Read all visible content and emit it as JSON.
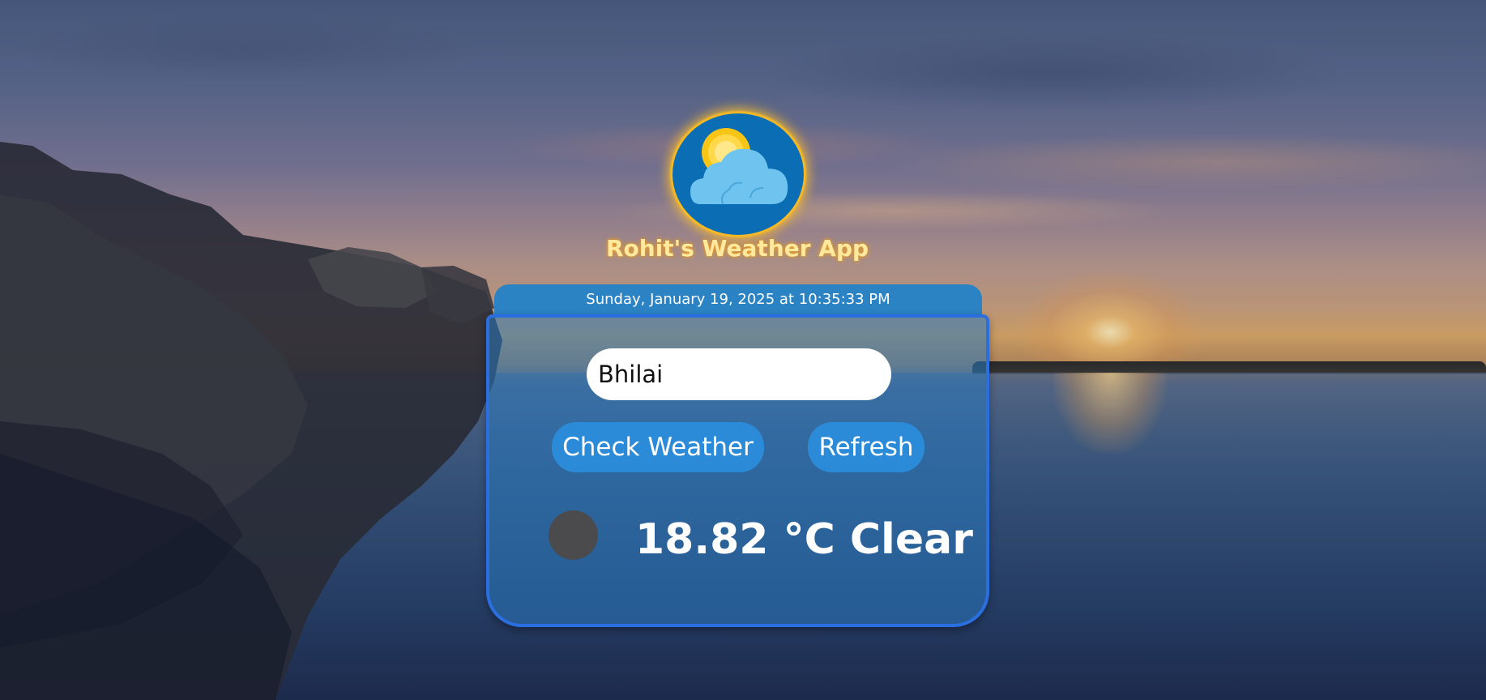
{
  "app": {
    "title": "Rohit's Weather App",
    "logo_icon": "sun-behind-cloud-icon"
  },
  "datetime": "Sunday, January 19, 2025 at 10:35:33 PM",
  "search": {
    "value": "Bhilai"
  },
  "buttons": {
    "check_label": "Check Weather",
    "refresh_label": "Refresh"
  },
  "weather": {
    "icon": "weather-condition-icon",
    "display": "18.82 °C Clear",
    "temperature": "18.82",
    "unit": "°C",
    "condition": "Clear"
  },
  "colors": {
    "card_border": "#2a6ee0",
    "button_bg": "#2c8bd8",
    "date_tab_bg": "#2b83c4",
    "title_color": "#ffe8a0",
    "logo_glow": "#f0b51d"
  }
}
